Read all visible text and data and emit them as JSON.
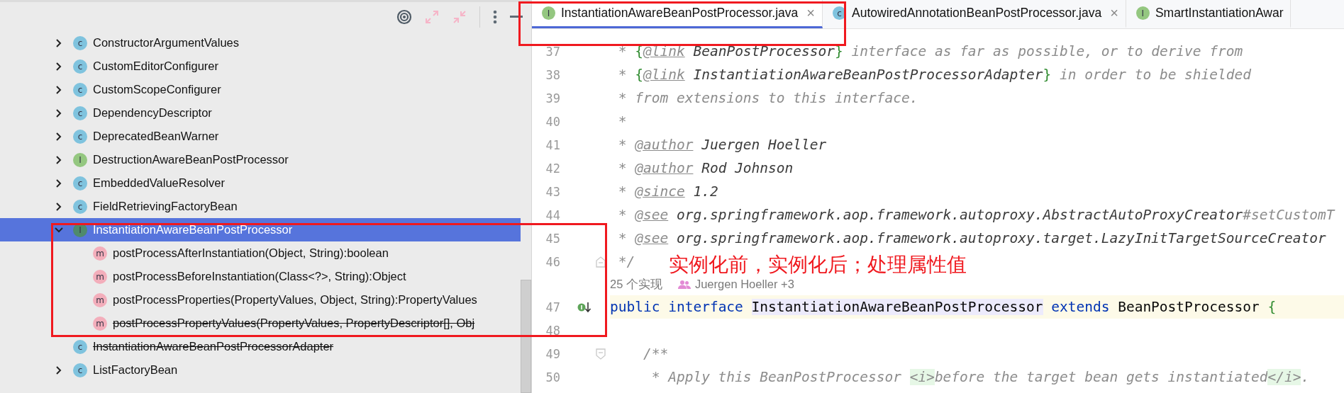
{
  "project_tree": {
    "items": [
      {
        "kind": "class",
        "badge": "c",
        "label": "ConstructorArgumentValues",
        "expandable": true,
        "expanded": false,
        "selected": false,
        "deprecated": false
      },
      {
        "kind": "class",
        "badge": "c",
        "label": "CustomEditorConfigurer",
        "expandable": true,
        "expanded": false,
        "selected": false,
        "deprecated": false
      },
      {
        "kind": "class",
        "badge": "c",
        "label": "CustomScopeConfigurer",
        "expandable": true,
        "expanded": false,
        "selected": false,
        "deprecated": false
      },
      {
        "kind": "class",
        "badge": "c",
        "label": "DependencyDescriptor",
        "expandable": true,
        "expanded": false,
        "selected": false,
        "deprecated": false
      },
      {
        "kind": "class",
        "badge": "c",
        "label": "DeprecatedBeanWarner",
        "expandable": true,
        "expanded": false,
        "selected": false,
        "deprecated": false
      },
      {
        "kind": "interface",
        "badge": "I",
        "label": "DestructionAwareBeanPostProcessor",
        "expandable": true,
        "expanded": false,
        "selected": false,
        "deprecated": false
      },
      {
        "kind": "class",
        "badge": "c",
        "label": "EmbeddedValueResolver",
        "expandable": true,
        "expanded": false,
        "selected": false,
        "deprecated": false
      },
      {
        "kind": "class",
        "badge": "c",
        "label": "FieldRetrievingFactoryBean",
        "expandable": true,
        "expanded": false,
        "selected": false,
        "deprecated": false
      },
      {
        "kind": "interface",
        "badge": "I",
        "label": "InstantiationAwareBeanPostProcessor",
        "expandable": true,
        "expanded": true,
        "selected": true,
        "deprecated": false,
        "children": [
          {
            "kind": "method",
            "badge": "m",
            "label": "postProcessAfterInstantiation(Object, String):boolean",
            "selected": false,
            "deprecated": false
          },
          {
            "kind": "method",
            "badge": "m",
            "label": "postProcessBeforeInstantiation(Class<?>, String):Object",
            "selected": false,
            "deprecated": false
          },
          {
            "kind": "method",
            "badge": "m",
            "label": "postProcessProperties(PropertyValues, Object, String):PropertyValues",
            "selected": false,
            "deprecated": false
          },
          {
            "kind": "method",
            "badge": "m",
            "label": "postProcessPropertyValues(PropertyValues, PropertyDescriptor[], Obj",
            "selected": false,
            "deprecated": true
          }
        ]
      },
      {
        "kind": "class",
        "badge": "c",
        "label": "InstantiationAwareBeanPostProcessorAdapter",
        "expandable": false,
        "selected": false,
        "deprecated": true
      },
      {
        "kind": "class",
        "badge": "c",
        "label": "ListFactoryBean",
        "expandable": true,
        "expanded": false,
        "selected": false,
        "deprecated": false
      }
    ]
  },
  "editor": {
    "tabs": [
      {
        "kind": "interface",
        "badge": "I",
        "label": "InstantiationAwareBeanPostProcessor.java",
        "close": "×",
        "selected": true
      },
      {
        "kind": "class",
        "badge": "c",
        "label": "AutowiredAnnotationBeanPostProcessor.java",
        "close": "×",
        "selected": false
      },
      {
        "kind": "interface",
        "badge": "I",
        "label": "SmartInstantiationAwar",
        "selected": false
      }
    ],
    "lines": [
      {
        "kind": "line",
        "number": "37",
        "segments": [
          {
            "kind": "comment",
            "text": " * "
          },
          {
            "kind": "brace",
            "text": "{"
          },
          {
            "kind": "tag",
            "text": "@link"
          },
          {
            "kind": "ref",
            "text": " BeanPostProcessor"
          },
          {
            "kind": "brace",
            "text": "}"
          },
          {
            "kind": "comment",
            "text": " interface as far as possible, or to derive from"
          }
        ]
      },
      {
        "kind": "line",
        "number": "38",
        "segments": [
          {
            "kind": "comment",
            "text": " * "
          },
          {
            "kind": "brace",
            "text": "{"
          },
          {
            "kind": "tag",
            "text": "@link"
          },
          {
            "kind": "ref",
            "text": " InstantiationAwareBeanPostProcessorAdapter"
          },
          {
            "kind": "brace",
            "text": "}"
          },
          {
            "kind": "comment",
            "text": " in order to be shielded"
          }
        ]
      },
      {
        "kind": "line",
        "number": "39",
        "segments": [
          {
            "kind": "comment",
            "text": " * from extensions to this interface."
          }
        ]
      },
      {
        "kind": "line",
        "number": "40",
        "segments": [
          {
            "kind": "comment",
            "text": " *"
          }
        ]
      },
      {
        "kind": "line",
        "number": "41",
        "segments": [
          {
            "kind": "comment",
            "text": " * "
          },
          {
            "kind": "tag",
            "text": "@author"
          },
          {
            "kind": "ref",
            "text": " Juergen Hoeller"
          }
        ]
      },
      {
        "kind": "line",
        "number": "42",
        "segments": [
          {
            "kind": "comment",
            "text": " * "
          },
          {
            "kind": "tag",
            "text": "@author"
          },
          {
            "kind": "ref",
            "text": " Rod Johnson"
          }
        ]
      },
      {
        "kind": "line",
        "number": "43",
        "segments": [
          {
            "kind": "comment",
            "text": " * "
          },
          {
            "kind": "tag",
            "text": "@since"
          },
          {
            "kind": "ref",
            "text": " 1.2"
          }
        ]
      },
      {
        "kind": "line",
        "number": "44",
        "segments": [
          {
            "kind": "comment",
            "text": " * "
          },
          {
            "kind": "tag",
            "text": "@see"
          },
          {
            "kind": "ref",
            "text": " org.springframework.aop.framework.autoproxy.AbstractAutoProxyCreator"
          },
          {
            "kind": "comment",
            "text": "#setCustomT"
          }
        ]
      },
      {
        "kind": "line",
        "number": "45",
        "segments": [
          {
            "kind": "comment",
            "text": " * "
          },
          {
            "kind": "tag",
            "text": "@see"
          },
          {
            "kind": "ref",
            "text": " org.springframework.aop.framework.autoproxy.target.LazyInitTargetSourceCreator"
          }
        ]
      },
      {
        "kind": "line",
        "number": "46",
        "gutter": {
          "kind": "fold-end"
        },
        "segments": [
          {
            "kind": "comment",
            "text": " */"
          }
        ]
      },
      {
        "kind": "hint",
        "usages": "25 个实现",
        "author": "Juergen Hoeller +3"
      },
      {
        "kind": "line",
        "number": "47",
        "gutter": {
          "kind": "implemented"
        },
        "current": true,
        "segments": [
          {
            "kind": "keyword",
            "text": "public "
          },
          {
            "kind": "keyword",
            "text": "interface "
          },
          {
            "kind": "highlight",
            "text": "InstantiationAwareBeanPostProcessor"
          },
          {
            "kind": "keyword",
            "text": " extends"
          },
          {
            "kind": "plain",
            "text": " BeanPostProcessor "
          },
          {
            "kind": "brace",
            "text": "{"
          }
        ]
      },
      {
        "kind": "line",
        "number": "48"
      },
      {
        "kind": "line",
        "number": "49",
        "gutter": {
          "kind": "fold-start"
        },
        "segments": [
          {
            "kind": "comment",
            "text": "    /**"
          }
        ]
      },
      {
        "kind": "line",
        "number": "50",
        "segments": [
          {
            "kind": "comment",
            "text": "     * Apply this BeanPostProcessor "
          },
          {
            "kind": "html",
            "text": "<i>"
          },
          {
            "kind": "comment",
            "text": "before the target bean gets instantiated"
          },
          {
            "kind": "html",
            "text": "</i>"
          },
          {
            "kind": "comment",
            "text": "."
          }
        ]
      }
    ]
  },
  "annotations": [
    {
      "kind": "box"
    },
    {
      "kind": "box"
    },
    {
      "kind": "note",
      "text": "实例化前，实例化后；处理属性值"
    }
  ]
}
